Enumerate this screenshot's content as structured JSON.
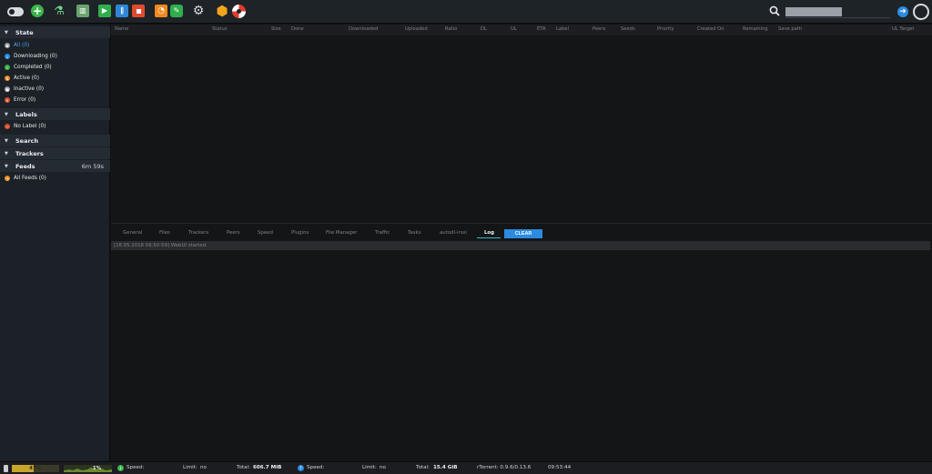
{
  "colors": {
    "accent": "#2a8be0",
    "active_text": "#4aa3f0",
    "downloading": "#2a8be0",
    "completed": "#3cb54a",
    "active": "#f08a1e",
    "inactive": "#9aa0a6",
    "error": "#e04b2f",
    "no_label": "#e04b2f",
    "feeds": "#f08a1e"
  },
  "toolbar": {
    "icons": [
      "toggle-icon",
      "add-torrent-icon",
      "create-torrent-icon",
      "remove-icon",
      "start-icon",
      "pause-icon",
      "stop-icon",
      "rss-icon",
      "chat-icon",
      "settings-icon",
      "plugin-cube-icon",
      "help-icon"
    ],
    "search_placeholder": "",
    "search_value": ""
  },
  "sidebar": {
    "state_title": "State",
    "states": [
      {
        "label": "All (0)",
        "icon": "all-icon",
        "color": "#9aa0a6"
      },
      {
        "label": "Downloading (0)",
        "icon": "downloading-icon",
        "color": "#2a8be0"
      },
      {
        "label": "Completed (0)",
        "icon": "completed-icon",
        "color": "#3cb54a"
      },
      {
        "label": "Active (0)",
        "icon": "active-icon",
        "color": "#f08a1e"
      },
      {
        "label": "Inactive (0)",
        "icon": "inactive-icon",
        "color": "#9aa0a6"
      },
      {
        "label": "Error (0)",
        "icon": "error-icon",
        "color": "#e04b2f"
      }
    ],
    "labels_title": "Labels",
    "no_label": "No Label (0)",
    "search_title": "Search",
    "trackers_title": "Trackers",
    "feeds_title": "Feeds",
    "feeds_time": "6m 59s",
    "all_feeds": "All Feeds (0)"
  },
  "list": {
    "columns": [
      "Name",
      "Status",
      "Size",
      "Done",
      "Downloaded",
      "Uploaded",
      "Ratio",
      "DL",
      "UL",
      "ETA",
      "Label",
      "Peers",
      "Seeds",
      "Priority",
      "Created On",
      "Remaining",
      "Save path",
      "UL Target"
    ],
    "rows": []
  },
  "details": {
    "tabs": [
      "General",
      "Files",
      "Trackers",
      "Peers",
      "Speed",
      "Plugins",
      "File Manager",
      "Traffic",
      "Tasks",
      "autodl-irssi",
      "Log"
    ],
    "active_tab": "Log",
    "clear_label": "CLEAR",
    "log": [
      "[28.05.2018 09:50:59] WebUI started."
    ]
  },
  "status": {
    "cpu_text": "47%",
    "cpu_value": 0.47,
    "mem_text": "1%",
    "dl_speed_label": "Speed:",
    "dl_speed_value": "",
    "dl_limit_label": "Limit:",
    "dl_limit_value": "no",
    "dl_total_label": "Total:",
    "dl_total_value": "606.7 MiB",
    "ul_speed_label": "Speed:",
    "ul_speed_value": "",
    "ul_limit_label": "Limit:",
    "ul_limit_value": "no",
    "ul_total_label": "Total:",
    "ul_total_value": "15.4 GiB",
    "version": "rTorrent: 0.9.6/0.13.6",
    "time": "09:53:44"
  }
}
